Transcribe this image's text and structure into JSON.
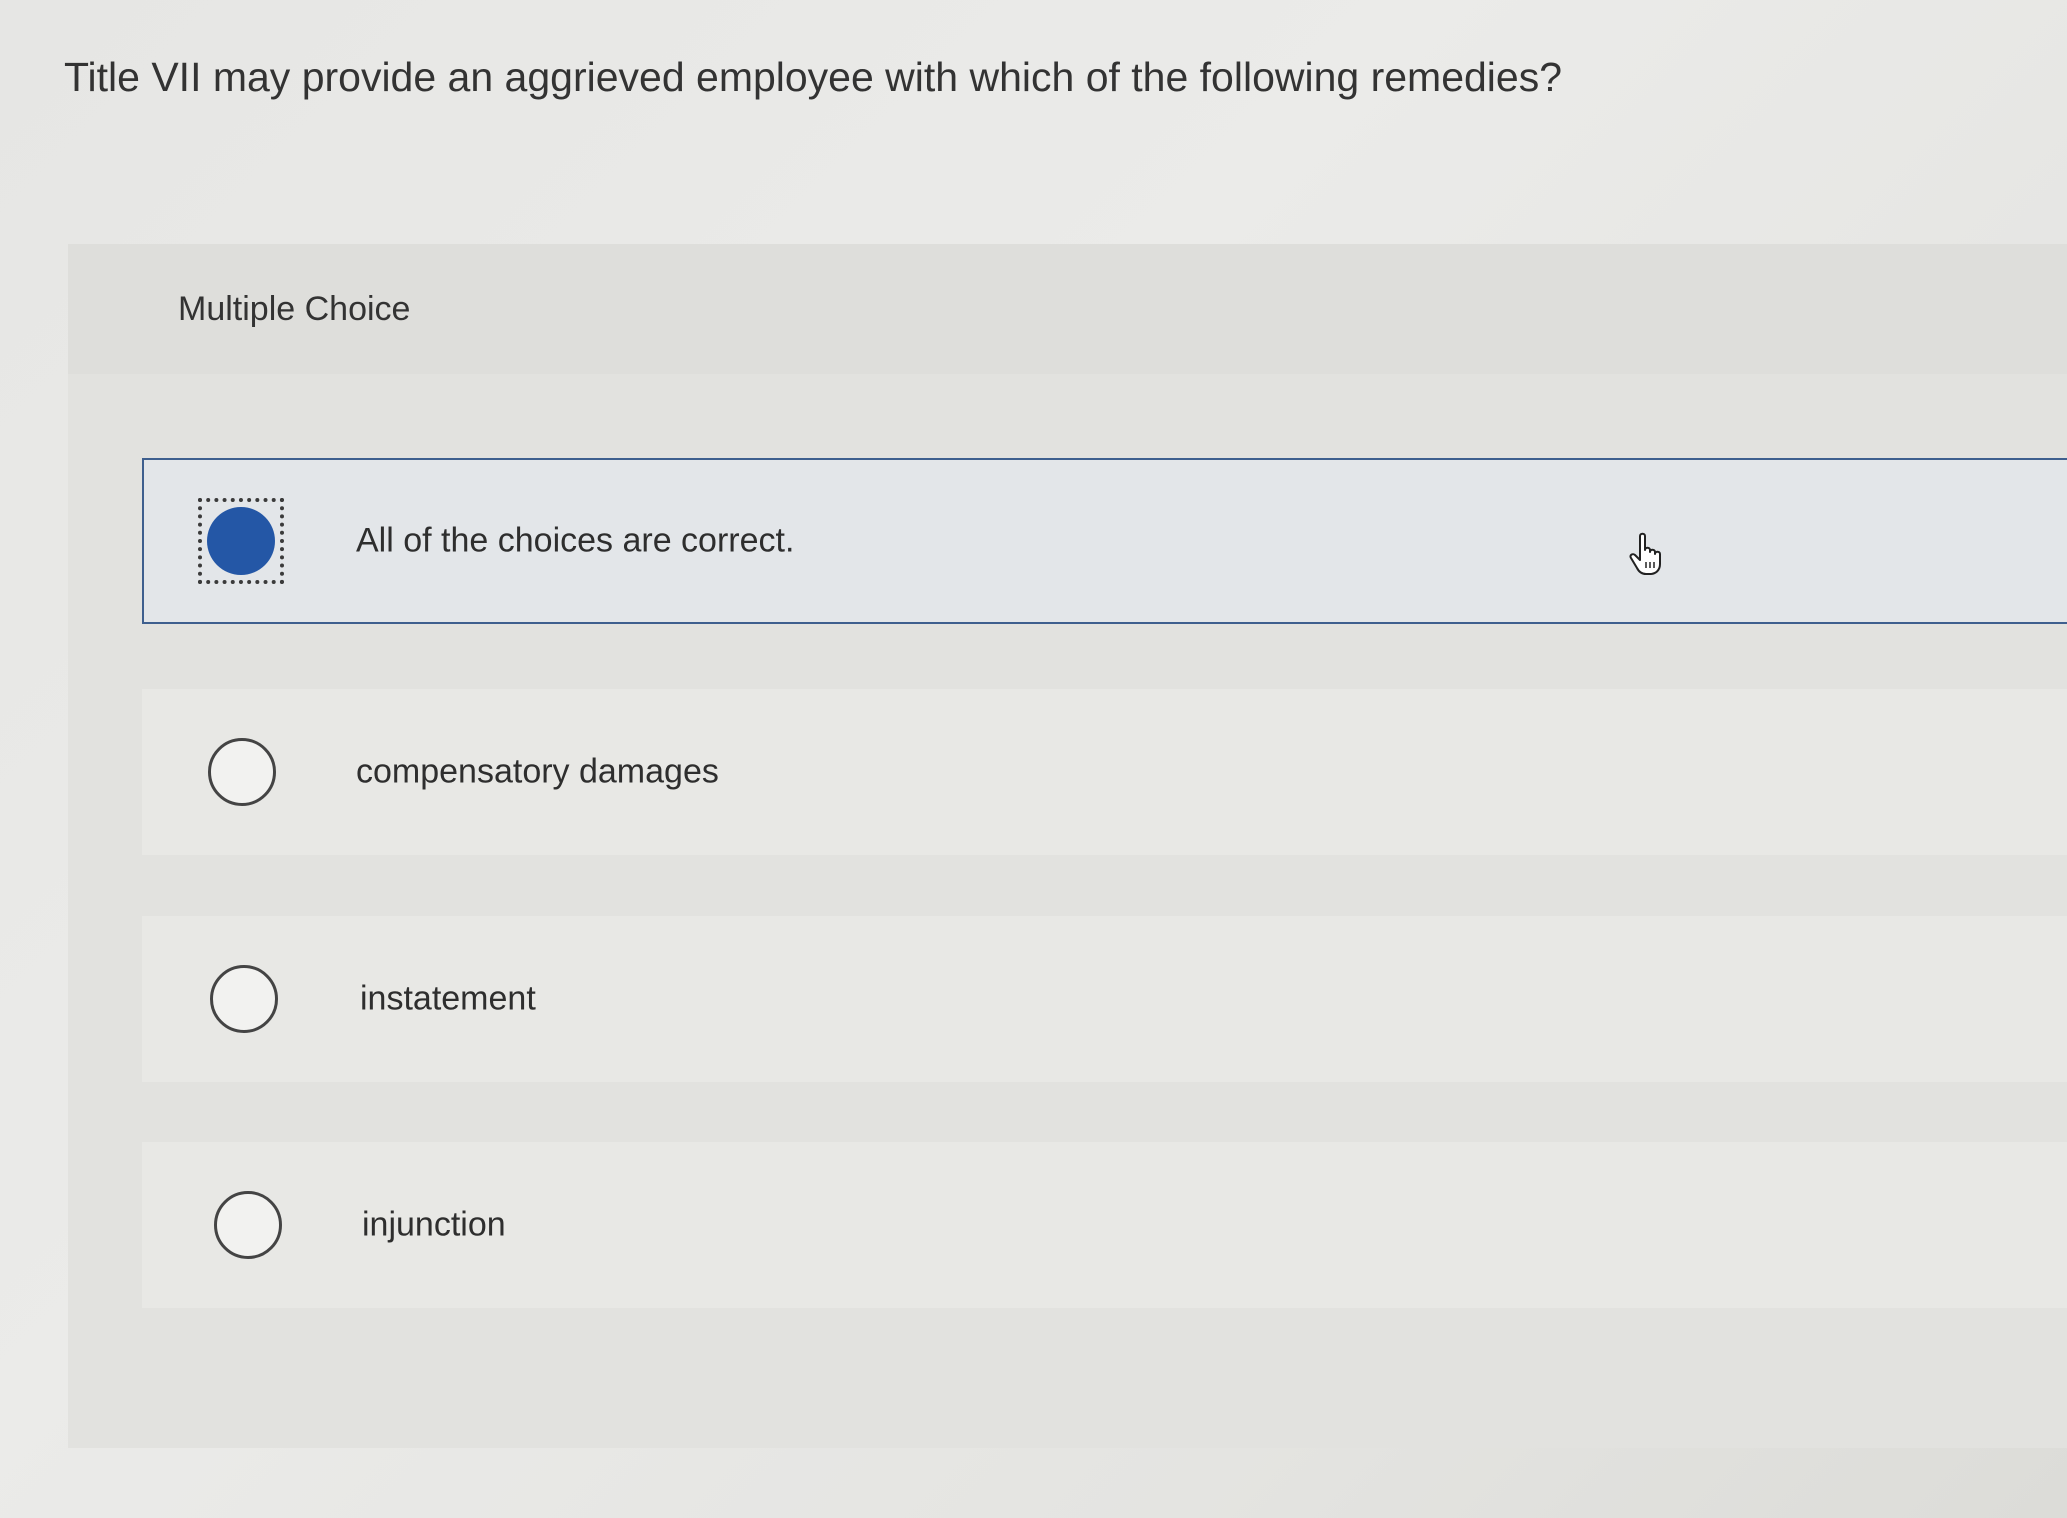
{
  "question": {
    "text": "Title VII may provide an aggrieved employee with which of the following remedies?"
  },
  "quiz": {
    "type_label": "Multiple Choice",
    "selected_index": 0,
    "choices": [
      {
        "label": "All of the choices are correct.",
        "selected": true
      },
      {
        "label": "compensatory damages",
        "selected": false
      },
      {
        "label": "instatement",
        "selected": false
      },
      {
        "label": "injunction",
        "selected": false
      }
    ]
  },
  "colors": {
    "selected_radio": "#2457a6",
    "selected_border": "#3e5f8e"
  },
  "icons": {
    "cursor": "hand-pointer-icon"
  }
}
